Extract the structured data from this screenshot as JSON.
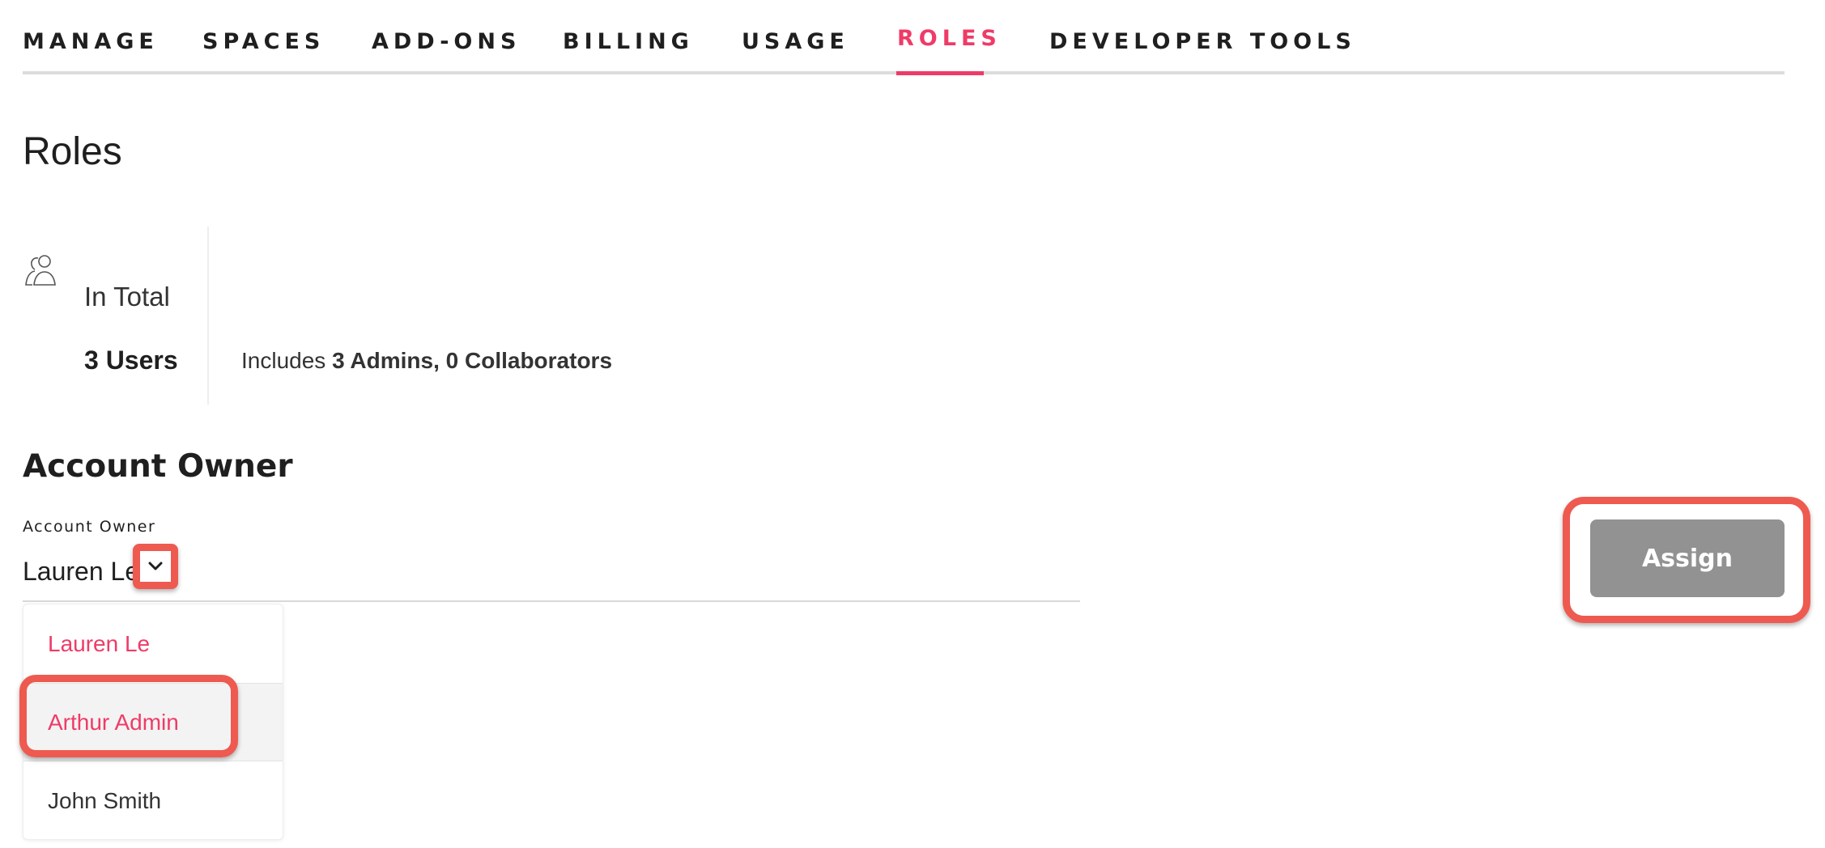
{
  "nav": {
    "tabs": [
      {
        "label": "MANAGE"
      },
      {
        "label": "SPACES"
      },
      {
        "label": "ADD-ONS"
      },
      {
        "label": "BILLING"
      },
      {
        "label": "USAGE"
      },
      {
        "label": "ROLES"
      },
      {
        "label": "DEVELOPER TOOLS"
      }
    ],
    "active_tab": "ROLES",
    "accent_color": "#ef3b67"
  },
  "page": {
    "title": "Roles"
  },
  "stats": {
    "icon": "users-icon",
    "label": "In Total",
    "count": "3 Users",
    "detail_prefix": "Includes",
    "admins": "3 Admins",
    "separator": ",",
    "collaborators": "0 Collaborators"
  },
  "account_owner": {
    "section_title": "Account Owner",
    "field_label": "Account Owner",
    "selected_value": "Lauren Le",
    "options": [
      "Lauren Le",
      "Arthur Admin",
      "John Smith"
    ],
    "hovered_option": "Arthur Admin",
    "assign_label": "Assign",
    "highlight_color": "#ee5a4f"
  }
}
